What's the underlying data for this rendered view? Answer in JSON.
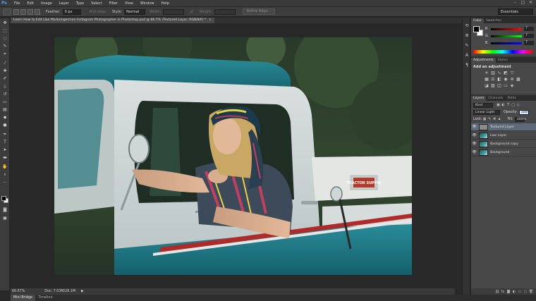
{
  "app": {
    "logo": "Ps",
    "menus": [
      "File",
      "Edit",
      "Image",
      "Layer",
      "Type",
      "Select",
      "Filter",
      "View",
      "Window",
      "Help"
    ],
    "window_controls": [
      "–",
      "□",
      "✕"
    ]
  },
  "options_bar": {
    "feather_label": "Feather:",
    "feather_value": "0 px",
    "antialias_label": "Anti-alias",
    "style_label": "Style:",
    "style_value": "Normal",
    "width_label": "Width:",
    "height_label": "Height:",
    "refine_edge": "Refine Edge...",
    "workspace": "Essentials"
  },
  "document": {
    "tab_title": "Learn How to Edit Like Marksingerman Instagram Photographer in Photoshop.psd @ 66.7% (Textured Layer, RGB/8#) *",
    "close": "×"
  },
  "status": {
    "zoom": "66.67%",
    "doc": "Doc: 7.03M/26.1M",
    "arrow": "▶"
  },
  "bottom_tabs": [
    "Mini Bridge",
    "Timeline"
  ],
  "color_panel": {
    "tabs": [
      "Color",
      "Swatches"
    ],
    "channels": [
      {
        "name": "R",
        "value": "7"
      },
      {
        "name": "G",
        "value": "7"
      },
      {
        "name": "B",
        "value": "7"
      }
    ]
  },
  "adjustments_panel": {
    "tabs": [
      "Adjustments",
      "Styles"
    ],
    "title": "Add an adjustment"
  },
  "layers_panel": {
    "tabs": [
      "Layers",
      "Channels",
      "Paths"
    ],
    "kind": "Kind",
    "blend_mode": "Linear Light",
    "opacity_label": "Opacity:",
    "opacity_value": "100%",
    "lock_label": "Lock:",
    "fill_label": "Fill:",
    "fill_value": "100%",
    "layers": [
      {
        "name": "Textured Layer",
        "selected": true
      },
      {
        "name": "Low Layer",
        "selected": false
      },
      {
        "name": "Background copy",
        "selected": false
      },
      {
        "name": "Background",
        "selected": false
      }
    ]
  },
  "photo": {
    "plate_text": "TRACTOR SUPPLY"
  }
}
